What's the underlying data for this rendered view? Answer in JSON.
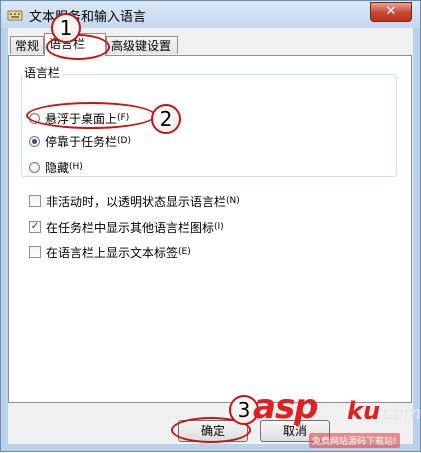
{
  "window": {
    "title": "文本服务和输入语言",
    "close_label": "✕"
  },
  "tabs": [
    {
      "label": "常规"
    },
    {
      "label": "语言栏"
    },
    {
      "label": "高级键设置"
    }
  ],
  "language_bar": {
    "group_label": "语言栏",
    "radios": [
      {
        "label": "悬浮于桌面上",
        "hotkey": "(F)",
        "checked": false
      },
      {
        "label": "停靠于任务栏",
        "hotkey": "(D)",
        "checked": true
      },
      {
        "label": "隐藏",
        "hotkey": "(H)",
        "checked": false
      }
    ],
    "checkboxes": [
      {
        "label": "非活动时，以透明状态显示语言栏",
        "hotkey": "(N)",
        "checked": false,
        "mark": ""
      },
      {
        "label": "在任务栏中显示其他语言栏图标",
        "hotkey": "(I)",
        "checked": true,
        "mark": "✓"
      },
      {
        "label": "在语言栏上显示文本标签",
        "hotkey": "(E)",
        "checked": false,
        "mark": ""
      }
    ]
  },
  "buttons": {
    "ok_label": "确定",
    "cancel_label": "取消"
  },
  "annotations": {
    "markers": [
      "1",
      "2",
      "3"
    ],
    "accent_color": "#c01818"
  },
  "watermark": {
    "brand": "asp",
    "suffix": "ku",
    "domain": ".com",
    "tagline": "免费网站源码下载站!"
  }
}
